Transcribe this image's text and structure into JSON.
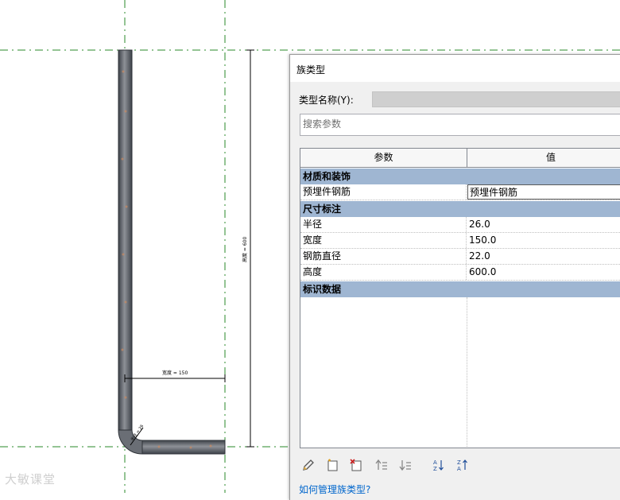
{
  "drawing": {
    "width_dim_label": "宽度 = 150",
    "height_dim_label": "高度 = 600",
    "radius_dim_label": "半径 = 26",
    "colors": {
      "ref_line": "#2a8a2a",
      "rebar_dark": "#4a4f57",
      "rebar_light": "#8c8f95"
    }
  },
  "dialog": {
    "title": "族类型",
    "type_name_label": "类型名称(Y):",
    "type_name_value": "",
    "search_placeholder": "搜索参数",
    "columns": {
      "param": "参数",
      "value": "值"
    },
    "groups": [
      {
        "name": "材质和装饰",
        "rows": [
          {
            "param": "预埋件钢筋",
            "value": "预埋件钢筋"
          }
        ]
      },
      {
        "name": "尺寸标注",
        "rows": [
          {
            "param": "半径",
            "value": "26.0"
          },
          {
            "param": "宽度",
            "value": "150.0"
          },
          {
            "param": "钢筋直径",
            "value": "22.0"
          },
          {
            "param": "高度",
            "value": "600.0"
          }
        ]
      },
      {
        "name": "标识数据",
        "rows": []
      }
    ],
    "toolbar_icons": [
      "pencil-icon",
      "new-type-icon",
      "delete-type-icon",
      "move-up-icon",
      "move-down-icon",
      "sort-ascending-icon",
      "sort-descending-icon"
    ],
    "help_link": "如何管理族类型?"
  },
  "watermark": "大敏课堂"
}
